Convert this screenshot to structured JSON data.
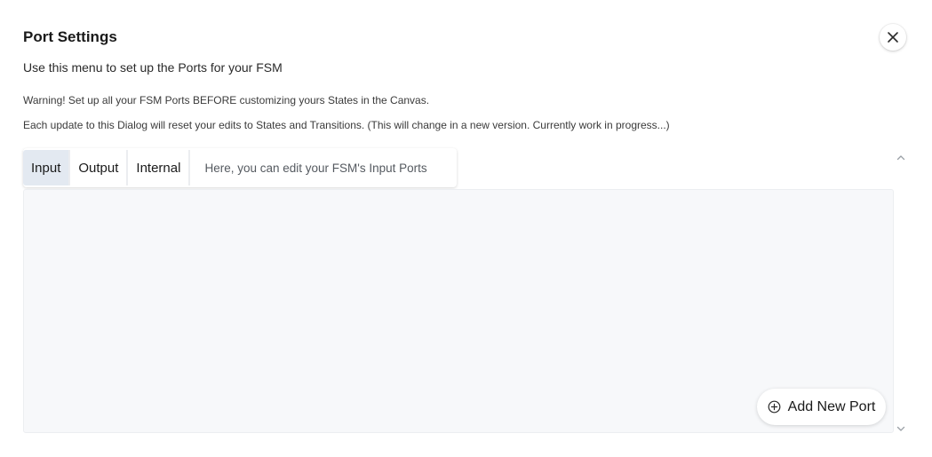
{
  "dialog": {
    "title": "Port Settings",
    "subtitle": "Use this menu to set up the Ports for your FSM",
    "warning": "Warning! Set up all your FSM Ports BEFORE customizing yours States in the Canvas.",
    "note": "Each update to this Dialog will reset your edits to States and Transitions. (This will change in a new version. Currently work in progress...)",
    "close_icon": "close-icon"
  },
  "tabs": {
    "items": [
      {
        "label": "Input",
        "active": true
      },
      {
        "label": "Output",
        "active": false
      },
      {
        "label": "Internal",
        "active": false
      }
    ],
    "hint": "Here, you can edit your FSM's Input Ports"
  },
  "panel": {
    "add_button_label": "Add New Port",
    "add_icon": "plus-circle-icon"
  },
  "scrollbar": {
    "up_icon": "chevron-up-icon",
    "down_icon": "chevron-down-icon"
  },
  "colors": {
    "active_tab_bg": "#e3e9f1",
    "panel_bg": "#f7f8fa"
  }
}
